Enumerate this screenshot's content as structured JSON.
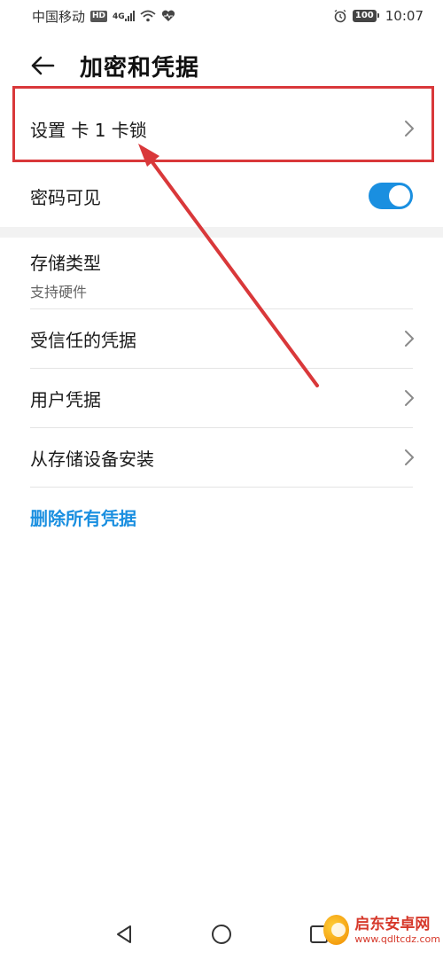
{
  "status_bar": {
    "carrier": "中国移动",
    "hd_badge": "HD",
    "network": "4G",
    "battery": "100",
    "time": "10:07",
    "icons": [
      "hd-icon",
      "signal-icon",
      "wifi-icon",
      "heart-icon",
      "alarm-icon",
      "battery-icon"
    ]
  },
  "header": {
    "title": "加密和凭据",
    "back_icon": "arrow-left-icon"
  },
  "items": {
    "sim_lock": {
      "label": "设置 卡 1 卡锁"
    },
    "password_visible": {
      "label": "密码可见",
      "toggle_on": true
    },
    "storage_type": {
      "label": "存储类型",
      "value": "支持硬件"
    },
    "trusted_credentials": {
      "label": "受信任的凭据"
    },
    "user_credentials": {
      "label": "用户凭据"
    },
    "install_from_storage": {
      "label": "从存储设备安装"
    },
    "clear_credentials": {
      "label": "删除所有凭据"
    }
  },
  "nav_bar": {
    "icons": [
      "nav-back-icon",
      "nav-home-icon",
      "nav-recents-icon"
    ]
  },
  "watermark": {
    "title": "启东安卓网",
    "url": "www.qdltcdz.com"
  },
  "colors": {
    "accent": "#1a8fe0",
    "annotation": "#d9383a",
    "divider": "#e4e4e4"
  }
}
